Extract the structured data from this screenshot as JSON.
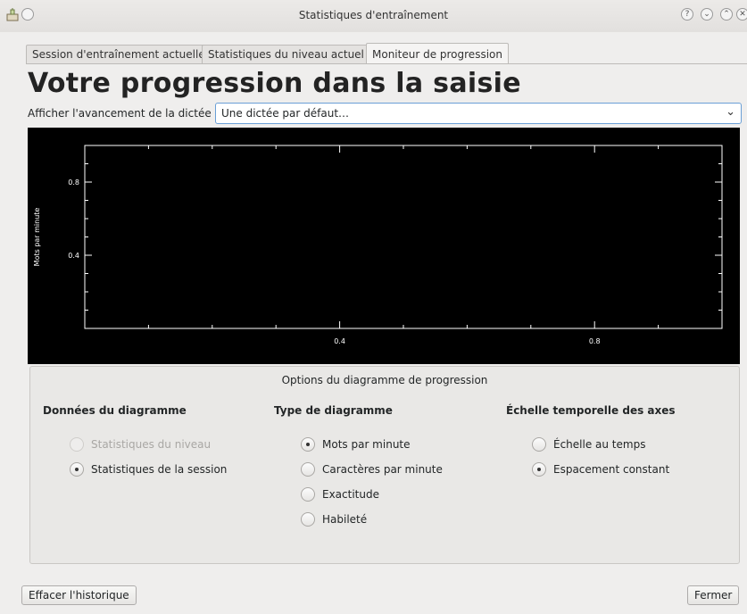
{
  "window": {
    "title": "Statistiques d'entraînement",
    "buttons": [
      "?",
      "⌄",
      "⌃",
      "✕"
    ]
  },
  "tabs": [
    {
      "label": "Session d'entraînement actuelle",
      "active": false
    },
    {
      "label": "Statistiques du niveau actuel",
      "active": false
    },
    {
      "label": "Moniteur de progression",
      "active": true
    }
  ],
  "heading": "Votre progression dans la saisie",
  "dictation": {
    "label": "Afficher l'avancement de la dictée :",
    "selected": "Une dictée par défaut…"
  },
  "chart_data": {
    "type": "line",
    "series": [],
    "ylabel": "Mots par minute",
    "xlabel": "",
    "y_ticks": [
      "0.8",
      "0.4"
    ],
    "x_ticks": [
      "0.4",
      "0.8"
    ],
    "xlim": [
      0,
      1
    ],
    "ylim": [
      0,
      1
    ],
    "background": "#000000",
    "axis_color": "#ffffff"
  },
  "options": {
    "title": "Options du diagramme de progression",
    "groups": [
      {
        "title": "Données du diagramme",
        "items": [
          {
            "label": "Statistiques du niveau",
            "checked": false,
            "disabled": true
          },
          {
            "label": "Statistiques de la session",
            "checked": true,
            "disabled": false
          }
        ]
      },
      {
        "title": "Type de diagramme",
        "items": [
          {
            "label": "Mots par minute",
            "checked": true,
            "disabled": false
          },
          {
            "label": "Caractères par minute",
            "checked": false,
            "disabled": false
          },
          {
            "label": "Exactitude",
            "checked": false,
            "disabled": false
          },
          {
            "label": "Habileté",
            "checked": false,
            "disabled": false
          }
        ]
      },
      {
        "title": "Échelle temporelle des axes",
        "items": [
          {
            "label": "Échelle au temps",
            "checked": false,
            "disabled": false
          },
          {
            "label": "Espacement constant",
            "checked": true,
            "disabled": false
          }
        ]
      }
    ]
  },
  "footer": {
    "clear_label": "Effacer l'historique",
    "close_label": "Fermer"
  }
}
